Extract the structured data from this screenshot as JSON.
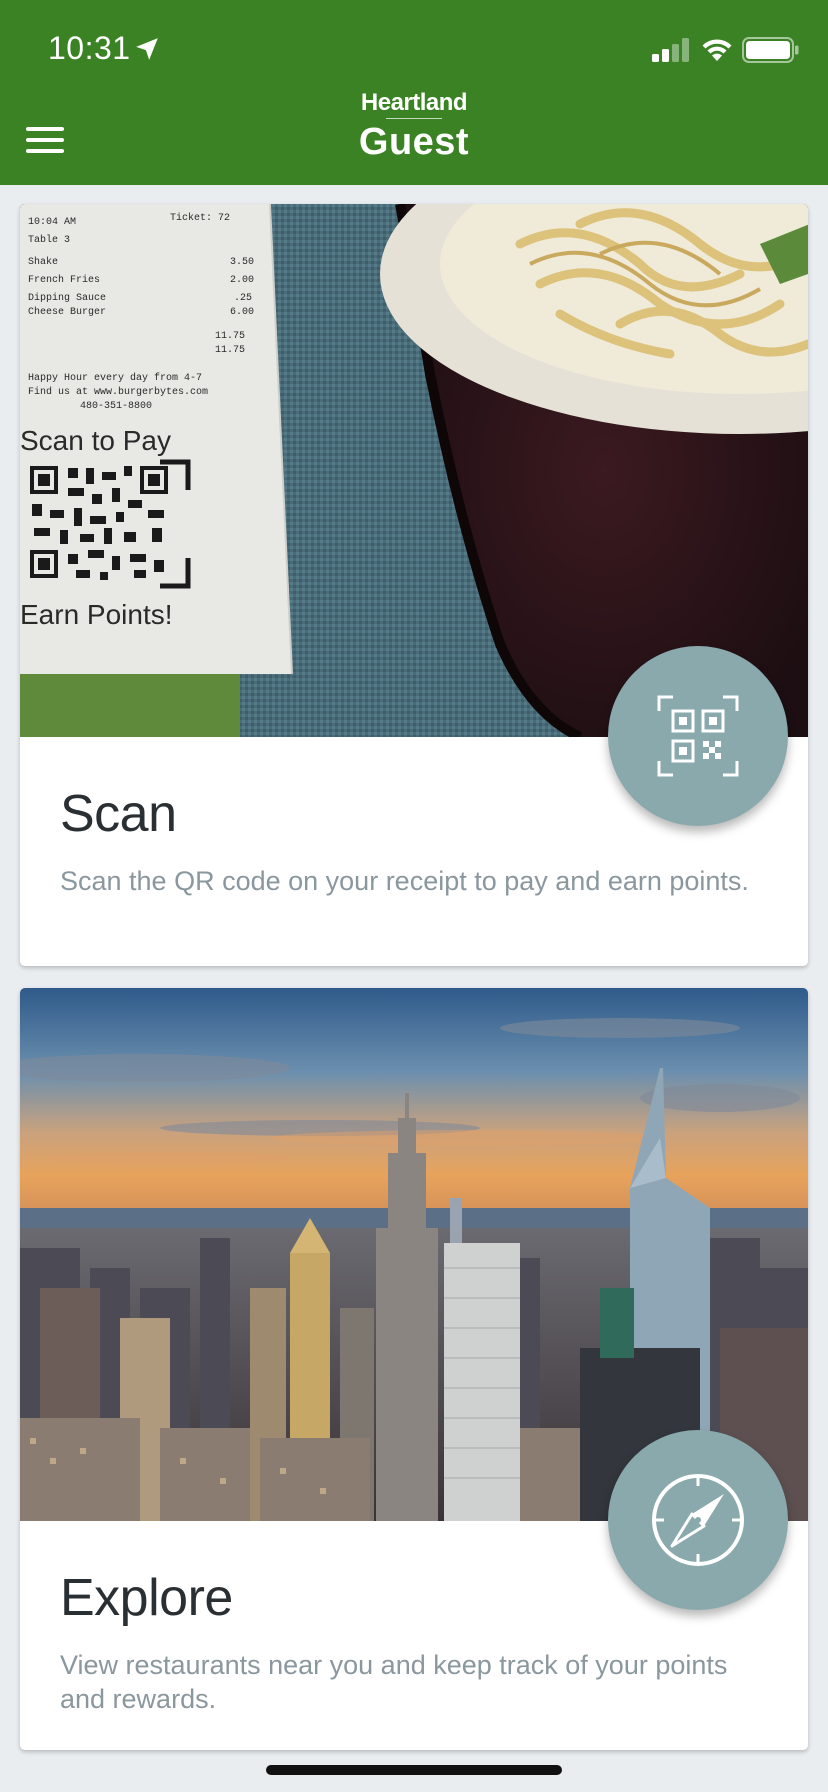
{
  "status_bar": {
    "time": "10:31"
  },
  "header": {
    "logo_top": "Heartland",
    "logo_bottom": "Guest",
    "background_color": "#3a8223"
  },
  "cards": [
    {
      "title": "Scan",
      "description": "Scan the QR code on your receipt to pay and earn points.",
      "image_receipt_lines": [
        "10:04 AM",
        "Ticket: 72",
        "Table 3",
        "Shake",
        "French Fries",
        "Dipping Sauce",
        "Cheese Burger",
        "Happy Hour every day from 4-7",
        "Find us at www.burgerbytes.com",
        "480-351-8800"
      ],
      "image_receipt_prices": [
        "3.50",
        "2.00",
        ".25",
        "6.00",
        "11.75",
        "11.75"
      ],
      "image_receipt_top_text": "Scan to Pay",
      "image_receipt_bottom_text": "Earn Points!",
      "icon": "qr-code-icon"
    },
    {
      "title": "Explore",
      "description": "View restaurants near you and keep track of your points and rewards.",
      "icon": "compass-icon"
    }
  ],
  "colors": {
    "fab": "#8aa9ad",
    "page_background": "#e9edf0"
  }
}
